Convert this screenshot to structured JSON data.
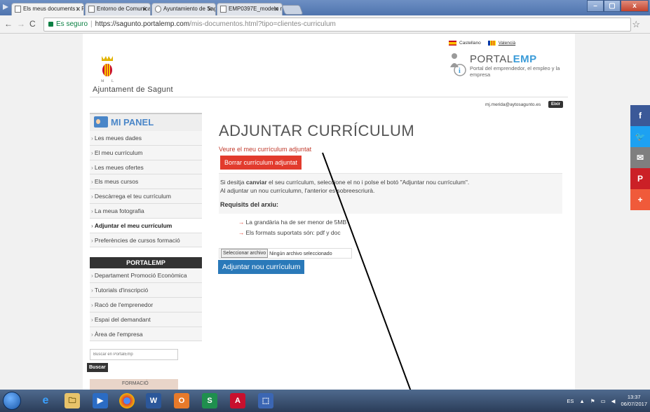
{
  "browser": {
    "tabs": [
      {
        "title": "Els meus documents :: Po",
        "active": true
      },
      {
        "title": "Entorno de Comunicació",
        "active": false
      },
      {
        "title": "Ayuntamiento de Sagunt",
        "active": false
      },
      {
        "title": "EMP0397E_modelo men",
        "active": false
      }
    ],
    "secure_label": "Es seguro",
    "url_host": "https://sagunto.portalemp.com",
    "url_path": "/mis-documentos.html?tipo=clientes-curriculum",
    "window_buttons": [
      "–",
      "▢",
      "x"
    ]
  },
  "header": {
    "city_name": "Ajuntament de Sagunt",
    "languages": [
      "Castellano",
      "Valencià"
    ],
    "portal_name_part1": "PORTAL",
    "portal_name_part2": "EMP",
    "portal_subtitle": "Portal del emprendedor, el empleo y la empresa",
    "user_email": "mj.merida@aytosagunto.es",
    "exit_label": "Eixir"
  },
  "sidebar": {
    "panel_title": "MI PANEL",
    "items": [
      "Les meues dades",
      "El meu currículum",
      "Les meues ofertes",
      "Els meus cursos",
      "Descàrrega el teu currículum",
      "La meua fotografia",
      "Adjuntar el meu currículum",
      "Preferències de cursos formació"
    ],
    "active_index": 6,
    "portal_heading": "PORTALEMP",
    "portal_items": [
      "Departament Promoció Econòmica",
      "Tutorials d'inscripció",
      "Racó de l'emprenedor",
      "Espai del demandant",
      "Àrea de l'empresa"
    ],
    "search_placeholder": "Buscar en PortalEmp",
    "search_button": "Buscar",
    "promo_text": "FORMACIÓ"
  },
  "main": {
    "title": "ADJUNTAR CURRÍCULUM",
    "view_link": "Veure el meu currículum adjuntat",
    "delete_button": "Borrar currículum adjuntat",
    "info_prefix": "Si desitja ",
    "info_bold": "canviar",
    "info_rest": " el seu currículum, seleccione el no i polse el botó \"Adjuntar nou currículum\".",
    "info_line2": "Al adjuntar un nou currículumn, l'anterior es sobreescriurà.",
    "requirements_title": "Requisits del arxiu:",
    "requirements": [
      "La grandària ha de ser menor de 5MB",
      "Els formats suportats són: pdf y doc"
    ],
    "file_button": "Seleccionar archivo",
    "file_status": "Ningún archivo seleccionado",
    "upload_button": "Adjuntar nou currículum"
  },
  "share": [
    {
      "icon": "f",
      "color": "#3b5998"
    },
    {
      "icon": "🐦",
      "color": "#1da1f2"
    },
    {
      "icon": "✉",
      "color": "#7f7f7f"
    },
    {
      "icon": "P",
      "color": "#cb2027"
    },
    {
      "icon": "+",
      "color": "#f05a3a"
    }
  ],
  "taskbar": {
    "language": "ES",
    "time": "13:37",
    "date": "06/07/2017",
    "apps": [
      "e",
      "🗀",
      "▶",
      "◉",
      "W",
      "O",
      "S",
      "A",
      "⬚"
    ]
  },
  "colors": {
    "accent_blue": "#2a79b9",
    "danger_red": "#e23b2d",
    "link_red": "#c0392b",
    "portal_blue": "#3a9bd8"
  }
}
